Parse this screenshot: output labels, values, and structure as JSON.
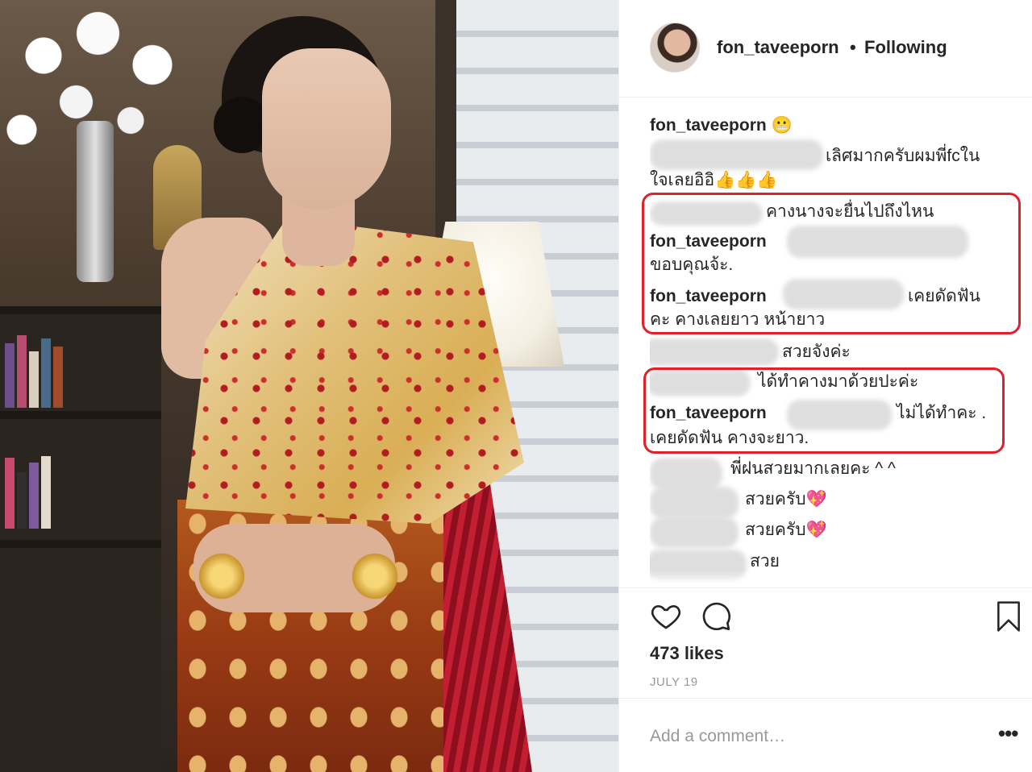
{
  "post": {
    "username": "fon_taveeporn",
    "separator": "•",
    "follow_status": "Following"
  },
  "comments": [
    {
      "user": "fon_taveeporn",
      "text": "😬"
    },
    {
      "user": "",
      "text": "เลิศมากครับผมพี่fcใน"
    },
    {
      "user": "",
      "text": "ใจเลยอิอิ👍👍👍"
    },
    {
      "user": "",
      "text": "คางนางจะยื่นไปถึงไหน"
    },
    {
      "user": "fon_taveeporn",
      "text": ""
    },
    {
      "user": "",
      "text": "ขอบคุณจ้ะ."
    },
    {
      "user": "fon_taveeporn",
      "text": "เคยดัดฟัน"
    },
    {
      "user": "",
      "text": "คะ คางเลยยาว หน้ายาว"
    },
    {
      "user": "",
      "text": "สวยจังค่ะ"
    },
    {
      "user": "",
      "text": "ได้ทำคางมาด้วยปะค่ะ"
    },
    {
      "user": "fon_taveeporn",
      "text": "ไม่ได้ทำคะ ."
    },
    {
      "user": "",
      "text": "เคยดัดฟัน คางจะยาว."
    },
    {
      "user": "",
      "text": "พี่ฝนสวยมากเลยคะ ^ ^"
    },
    {
      "user": "",
      "text": "สวยครับ💖"
    },
    {
      "user": "",
      "text": "สวยครับ💖"
    },
    {
      "user": "",
      "text": "สวย"
    }
  ],
  "actions": {
    "like_icon": "heart-icon",
    "comment_icon": "comment-bubble-icon",
    "save_icon": "bookmark-icon"
  },
  "likes_label": "473 likes",
  "date_label": "JULY 19",
  "add_comment": {
    "placeholder": "Add a comment…",
    "more_label": "•••"
  },
  "colors": {
    "text": "#262626",
    "muted": "#999999",
    "divider": "#efefef",
    "highlight_box": "#e0202a"
  }
}
